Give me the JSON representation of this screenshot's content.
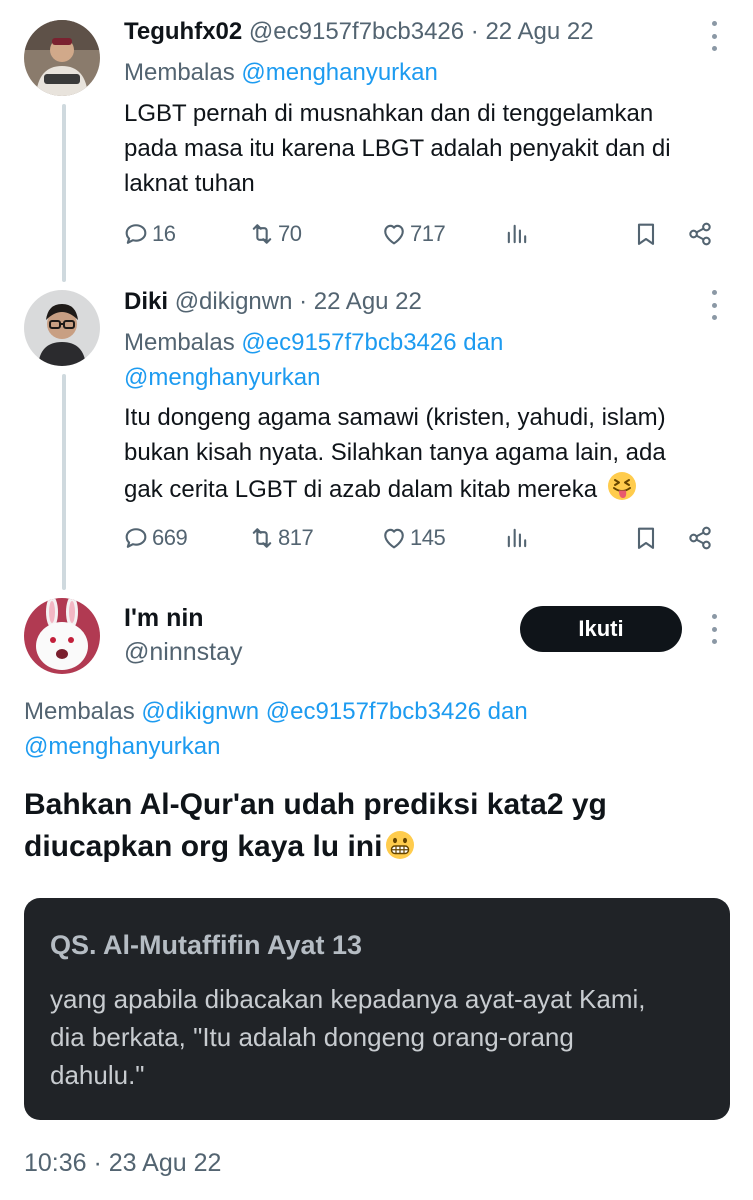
{
  "tweets": [
    {
      "name": "Teguhfx02",
      "handle": "@ec9157f7bcb3426",
      "date": "· 22 Agu 22",
      "reply_label": "Membalas",
      "reply_line1": "@menghanyurkan",
      "text_lines": [
        "LGBT pernah di musnahkan dan di tenggelamkan",
        "pada masa itu karena LBGT adalah penyakit dan di",
        "laknat  tuhan"
      ],
      "replies": "16",
      "retweets": "70",
      "likes": "717"
    },
    {
      "name": "Diki",
      "handle": "@dikignwn",
      "date": "· 22 Agu 22",
      "reply_label": "Membalas",
      "reply_line1": "@ec9157f7bcb3426 dan",
      "reply_line2": "@menghanyurkan",
      "text_lines": [
        "Itu dongeng agama samawi (kristen, yahudi, islam)",
        "bukan kisah nyata. Silahkan tanya agama lain, ada",
        "gak cerita LGBT di azab dalam kitab mereka"
      ],
      "replies": "669",
      "retweets": "817",
      "likes": "145"
    }
  ],
  "main_tweet": {
    "name": "I'm nin",
    "handle": "@ninnstay",
    "follow_label": "Ikuti",
    "reply_label": "Membalas",
    "reply_line1": "@dikignwn @ec9157f7bcb3426 dan",
    "reply_line2": "@menghanyurkan",
    "text_line1": "Bahkan Al-Qur'an udah prediksi kata2 yg",
    "text_line2": "diucapkan org kaya lu ini",
    "quote_title": "QS. Al-Mutaffifin Ayat 13",
    "quote_text": "yang apabila dibacakan kepadanya ayat-ayat Kami, dia berkata, \"Itu adalah dongeng orang-orang dahulu.\"",
    "timestamp": "10:36 · 23 Agu 22"
  },
  "colors": {
    "link": "#1d9bf0",
    "muted": "#536471",
    "quote_bg": "#202327",
    "follow_bg": "#0f1419"
  },
  "icons": [
    "reply-icon",
    "retweet-icon",
    "like-icon",
    "views-icon",
    "bookmark-icon",
    "share-icon",
    "more-icon",
    "tongue-emoji",
    "grimace-emoji"
  ]
}
